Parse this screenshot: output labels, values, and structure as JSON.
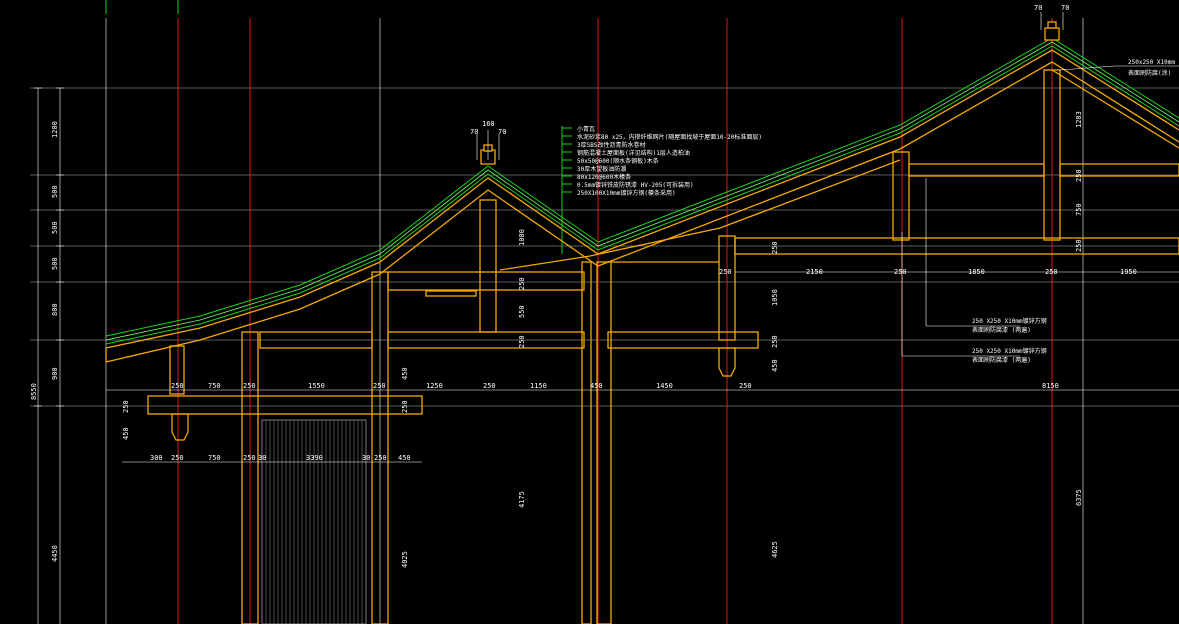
{
  "drawing": {
    "background": "#000000",
    "colors": {
      "axis": "#e01818",
      "structure": "#f5a800",
      "roof_layer": "#19d219",
      "dimension": "#ffffff",
      "infill": "#9a9a9a"
    }
  },
  "left_vertical_dims": {
    "total": "8550",
    "segments": [
      "1200",
      "500",
      "500",
      "500",
      "800",
      "900"
    ],
    "lower": "4450"
  },
  "ridge_top_dims": {
    "left": "70",
    "right": "70"
  },
  "gable_ridge_dims": {
    "width": "160",
    "left": "70",
    "right": "70"
  },
  "roof_layer_notes": [
    "小青瓦",
    "水泥砂浆80 x25，内掺纤维网片(随屋面找坡于屋面10-20标准面层)",
    "3厚SBS改性沥青防水卷材",
    "钢筋混凝土屋面板(详见结构)1层人造柏油",
    "50x50@600(顺水条钢板)木条",
    "30厚木望板油防潮",
    "80x120@600木椽条",
    "0.5mm镀锌铁皮防锈漆 HV-205(可拆装用)",
    "250X100X10mm镀锌方钢(檩条采用)"
  ],
  "top_right_notes": [
    "250x250 X10mm",
    "表面刷防腐(涂)"
  ],
  "beam_notes": [
    {
      "line1": "250 X250 X10mm镀锌方钢",
      "line2": "表面刷防腐漆 (两遍)"
    },
    {
      "line1": "250 X250 X10mm镀锌方钢",
      "line2": "表面刷防腐漆 (两遍)"
    }
  ],
  "horizontal_dims_row1": [
    "250",
    "750",
    "250",
    "1550",
    "250",
    "1250",
    "250",
    "1150",
    "450",
    "1450",
    "250",
    "8150"
  ],
  "horizontal_dims_row2": [
    "300",
    "250",
    "750",
    "250",
    "30",
    "3390",
    "30",
    "250",
    "450"
  ],
  "upper_beam_dims": [
    "250",
    "2150",
    "250",
    "1850",
    "250",
    "1950"
  ],
  "vertical_dims_mid": [
    "450",
    "250",
    "250",
    "550",
    "250",
    "1000",
    "4175",
    "4025"
  ],
  "vertical_dims_right": [
    "250",
    "1050",
    "450",
    "250",
    "4625"
  ],
  "vertical_dims_far_right": [
    "1283",
    "250",
    "750",
    "250",
    "6375"
  ]
}
